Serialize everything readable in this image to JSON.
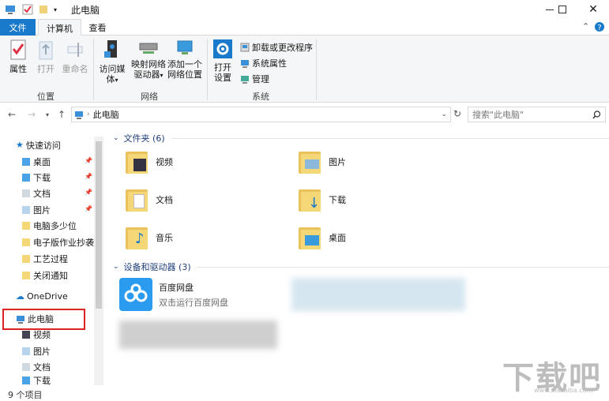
{
  "window": {
    "title": "此电脑"
  },
  "ribbon_tabs": {
    "file": "文件",
    "computer": "计算机",
    "view": "查看"
  },
  "ribbon": {
    "properties": "属性",
    "open": "打开",
    "rename": "重命名",
    "access_media": "访问媒体",
    "map_drive_line1": "映射网络",
    "map_drive_line2": "驱动器",
    "add_location_line1": "添加一个",
    "add_location_line2": "网络位置",
    "open_settings_line1": "打开",
    "open_settings_line2": "设置",
    "uninstall": "卸载或更改程序",
    "system_props": "系统属性",
    "manage": "管理",
    "group_location": "位置",
    "group_network": "网络",
    "group_system": "系统"
  },
  "address": {
    "path": "此电脑",
    "search_placeholder": "搜索\"此电脑\""
  },
  "nav": {
    "quick_access": "快速访问",
    "items": [
      "桌面",
      "下载",
      "文档",
      "图片",
      "电脑多少位",
      "电子版作业抄袭",
      "工艺过程",
      "关闭通知"
    ],
    "onedrive": "OneDrive",
    "this_pc": "此电脑",
    "sub_items": [
      "视频",
      "图片",
      "文档",
      "下载"
    ]
  },
  "content": {
    "folders_header": "文件夹 (6)",
    "folders": [
      "视频",
      "图片",
      "文档",
      "下载",
      "音乐",
      "桌面"
    ],
    "devices_header": "设备和驱动器 (3)",
    "baidu_name": "百度网盘",
    "baidu_desc": "双击运行百度网盘"
  },
  "status": {
    "count": "9 个项目"
  },
  "watermark": {
    "text": "下载吧",
    "sub": "www.xiazaiba.com"
  },
  "colors": {
    "accent": "#1979ca",
    "highlight_border": "#dd2222",
    "folder": "#f5d778"
  }
}
